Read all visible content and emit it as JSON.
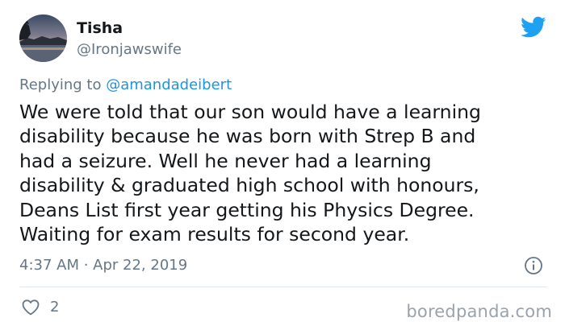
{
  "author": {
    "display_name": "Tisha",
    "handle": "@Ironjawswife"
  },
  "reply": {
    "prefix": "Replying to ",
    "mention": "@amandadeibert"
  },
  "tweet": {
    "text": "We were told that our son would have a learning\ndisability because he was born with Strep B and\nhad a seizure. Well he never had a learning\ndisability & graduated high school with honours,\nDeans List first year getting his Physics Degree.\nWaiting for exam results for second year.",
    "timestamp": "4:37 AM · Apr 22, 2019"
  },
  "actions": {
    "like_count": "2"
  },
  "watermark": "boredpanda.com",
  "icons": {
    "brand": "twitter-bird-icon",
    "info": "info-icon",
    "like": "heart-icon"
  },
  "colors": {
    "brand_blue": "#1da1f2",
    "mention_blue": "#1b95e0",
    "secondary_text": "#657786",
    "primary_text": "#14171a"
  }
}
